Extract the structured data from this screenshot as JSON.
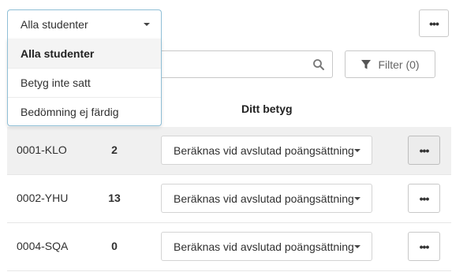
{
  "filter_select": {
    "selected": "Alla studenter",
    "options": [
      "Alla studenter",
      "Betyg inte satt",
      "Bedömning ej färdig"
    ]
  },
  "toolbar": {
    "more_label": "•••",
    "search_icon": "search-icon",
    "filter_label": "Filter (0)",
    "filter_icon": "funnel-icon"
  },
  "table": {
    "grade_column_header": "Ditt betyg",
    "rows": [
      {
        "student_id": "0001-KLO",
        "count": "2",
        "grade": "Beräknas vid avslutad poängsättning",
        "more_label": "•••"
      },
      {
        "student_id": "0002-YHU",
        "count": "13",
        "grade": "Beräknas vid avslutad poängsättning",
        "more_label": "•••"
      },
      {
        "student_id": "0004-SQA",
        "count": "0",
        "grade": "Beräknas vid avslutad poängsättning",
        "more_label": "•••"
      }
    ]
  },
  "colors": {
    "dropdown_border": "#8fbfd6",
    "row_highlight": "#f0f0f0",
    "border": "#c8c8c8"
  }
}
